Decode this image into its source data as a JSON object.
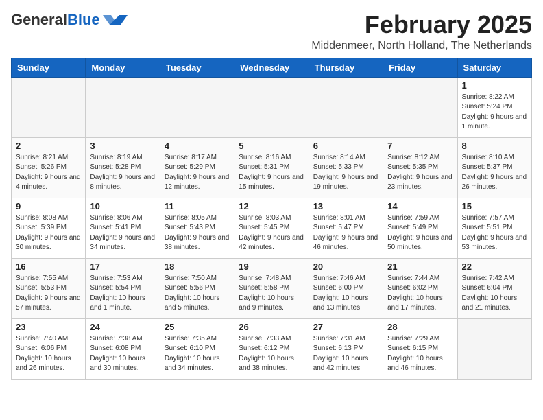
{
  "header": {
    "logo_line1": "General",
    "logo_line2": "Blue",
    "month": "February 2025",
    "location": "Middenmeer, North Holland, The Netherlands"
  },
  "weekdays": [
    "Sunday",
    "Monday",
    "Tuesday",
    "Wednesday",
    "Thursday",
    "Friday",
    "Saturday"
  ],
  "weeks": [
    [
      {
        "day": "",
        "info": ""
      },
      {
        "day": "",
        "info": ""
      },
      {
        "day": "",
        "info": ""
      },
      {
        "day": "",
        "info": ""
      },
      {
        "day": "",
        "info": ""
      },
      {
        "day": "",
        "info": ""
      },
      {
        "day": "1",
        "info": "Sunrise: 8:22 AM\nSunset: 5:24 PM\nDaylight: 9 hours and 1 minute."
      }
    ],
    [
      {
        "day": "2",
        "info": "Sunrise: 8:21 AM\nSunset: 5:26 PM\nDaylight: 9 hours and 4 minutes."
      },
      {
        "day": "3",
        "info": "Sunrise: 8:19 AM\nSunset: 5:28 PM\nDaylight: 9 hours and 8 minutes."
      },
      {
        "day": "4",
        "info": "Sunrise: 8:17 AM\nSunset: 5:29 PM\nDaylight: 9 hours and 12 minutes."
      },
      {
        "day": "5",
        "info": "Sunrise: 8:16 AM\nSunset: 5:31 PM\nDaylight: 9 hours and 15 minutes."
      },
      {
        "day": "6",
        "info": "Sunrise: 8:14 AM\nSunset: 5:33 PM\nDaylight: 9 hours and 19 minutes."
      },
      {
        "day": "7",
        "info": "Sunrise: 8:12 AM\nSunset: 5:35 PM\nDaylight: 9 hours and 23 minutes."
      },
      {
        "day": "8",
        "info": "Sunrise: 8:10 AM\nSunset: 5:37 PM\nDaylight: 9 hours and 26 minutes."
      }
    ],
    [
      {
        "day": "9",
        "info": "Sunrise: 8:08 AM\nSunset: 5:39 PM\nDaylight: 9 hours and 30 minutes."
      },
      {
        "day": "10",
        "info": "Sunrise: 8:06 AM\nSunset: 5:41 PM\nDaylight: 9 hours and 34 minutes."
      },
      {
        "day": "11",
        "info": "Sunrise: 8:05 AM\nSunset: 5:43 PM\nDaylight: 9 hours and 38 minutes."
      },
      {
        "day": "12",
        "info": "Sunrise: 8:03 AM\nSunset: 5:45 PM\nDaylight: 9 hours and 42 minutes."
      },
      {
        "day": "13",
        "info": "Sunrise: 8:01 AM\nSunset: 5:47 PM\nDaylight: 9 hours and 46 minutes."
      },
      {
        "day": "14",
        "info": "Sunrise: 7:59 AM\nSunset: 5:49 PM\nDaylight: 9 hours and 50 minutes."
      },
      {
        "day": "15",
        "info": "Sunrise: 7:57 AM\nSunset: 5:51 PM\nDaylight: 9 hours and 53 minutes."
      }
    ],
    [
      {
        "day": "16",
        "info": "Sunrise: 7:55 AM\nSunset: 5:53 PM\nDaylight: 9 hours and 57 minutes."
      },
      {
        "day": "17",
        "info": "Sunrise: 7:53 AM\nSunset: 5:54 PM\nDaylight: 10 hours and 1 minute."
      },
      {
        "day": "18",
        "info": "Sunrise: 7:50 AM\nSunset: 5:56 PM\nDaylight: 10 hours and 5 minutes."
      },
      {
        "day": "19",
        "info": "Sunrise: 7:48 AM\nSunset: 5:58 PM\nDaylight: 10 hours and 9 minutes."
      },
      {
        "day": "20",
        "info": "Sunrise: 7:46 AM\nSunset: 6:00 PM\nDaylight: 10 hours and 13 minutes."
      },
      {
        "day": "21",
        "info": "Sunrise: 7:44 AM\nSunset: 6:02 PM\nDaylight: 10 hours and 17 minutes."
      },
      {
        "day": "22",
        "info": "Sunrise: 7:42 AM\nSunset: 6:04 PM\nDaylight: 10 hours and 21 minutes."
      }
    ],
    [
      {
        "day": "23",
        "info": "Sunrise: 7:40 AM\nSunset: 6:06 PM\nDaylight: 10 hours and 26 minutes."
      },
      {
        "day": "24",
        "info": "Sunrise: 7:38 AM\nSunset: 6:08 PM\nDaylight: 10 hours and 30 minutes."
      },
      {
        "day": "25",
        "info": "Sunrise: 7:35 AM\nSunset: 6:10 PM\nDaylight: 10 hours and 34 minutes."
      },
      {
        "day": "26",
        "info": "Sunrise: 7:33 AM\nSunset: 6:12 PM\nDaylight: 10 hours and 38 minutes."
      },
      {
        "day": "27",
        "info": "Sunrise: 7:31 AM\nSunset: 6:13 PM\nDaylight: 10 hours and 42 minutes."
      },
      {
        "day": "28",
        "info": "Sunrise: 7:29 AM\nSunset: 6:15 PM\nDaylight: 10 hours and 46 minutes."
      },
      {
        "day": "",
        "info": ""
      }
    ]
  ]
}
